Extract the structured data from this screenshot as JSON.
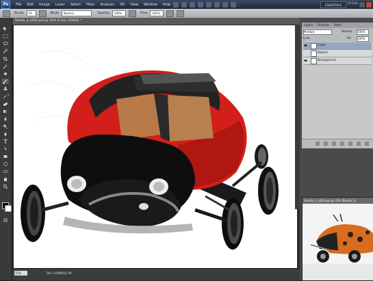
{
  "menubar": {
    "logo": "Ps",
    "items": [
      "File",
      "Edit",
      "Image",
      "Layer",
      "Select",
      "Filter",
      "Analysis",
      "3D",
      "View",
      "Window",
      "Help"
    ],
    "workspace": "ESSENTIALS",
    "cs_live": "CS Live"
  },
  "options": {
    "brush_label": "Brush:",
    "brush_size": "19",
    "mode_label": "Mode:",
    "mode_value": "Normal",
    "opacity_label": "Opacity:",
    "opacity_value": "100%",
    "flow_label": "Flow:",
    "flow_value": "100%"
  },
  "document": {
    "title": "Beetle_3_v004.psd @ 33% (Color, RGB/8) *",
    "zoom": "33%",
    "doc_info": "Doc: 8.46M/56.1M"
  },
  "layers_panel": {
    "tabs": [
      "Layers",
      "Channels",
      "Paths"
    ],
    "blend_mode": "Multiply",
    "opacity_label": "Opacity:",
    "opacity_value": "100%",
    "lock_label": "Lock:",
    "fill_label": "Fill:",
    "fill_value": "100%",
    "layers": [
      {
        "name": "Color",
        "selected": true
      },
      {
        "name": "Sketch",
        "selected": false
      },
      {
        "name": "Background",
        "selected": false
      }
    ]
  },
  "second_doc": {
    "title": "Beetle_3_v004.psd @ 33% (Beetle_3)"
  }
}
